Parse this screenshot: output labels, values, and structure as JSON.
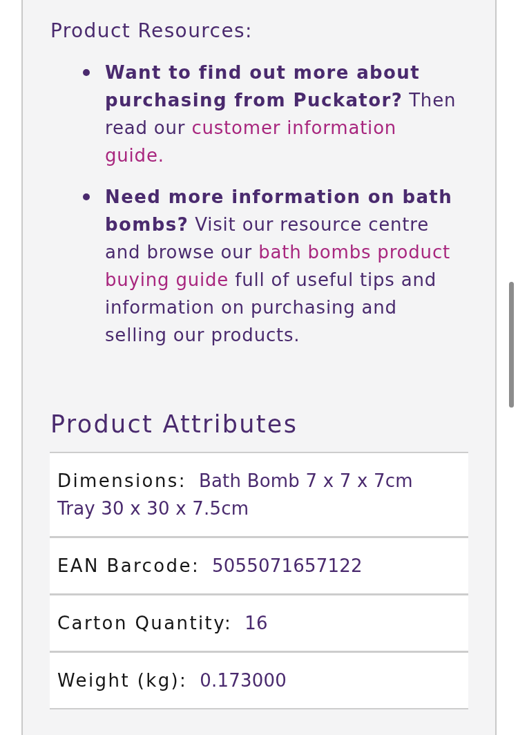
{
  "resources": {
    "heading": "Product Resources:",
    "items": [
      {
        "parts": [
          {
            "kind": "text",
            "text": "**Want to find out more about purchasing from Puckator?** Then read our"
          },
          {
            "kind": "link",
            "text": "customer information"
          },
          {
            "kind": "link",
            "text": "guide."
          }
        ]
      },
      {
        "parts": [
          {
            "kind": "text",
            "text": "**Need more information on bath bombs?** Visit our resource centre and browse our"
          },
          {
            "kind": "link",
            "text": "bath bombs product"
          },
          {
            "kind": "link",
            "text": "buying guide"
          },
          {
            "kind": "text",
            "text": "full of useful tips and information on purchasing and selling our products."
          }
        ]
      }
    ]
  },
  "attributes": {
    "heading": "Product Attributes",
    "rows": [
      {
        "label": "Dimensions:",
        "values": [
          "Bath Bomb 7 x 7 x 7cm",
          "Tray 30 x 30 x 7.5cm"
        ]
      },
      {
        "label": "EAN Barcode:",
        "values": [
          "5055071657122"
        ]
      },
      {
        "label": "Carton Quantity:",
        "values": [
          "16"
        ]
      },
      {
        "label": "Weight (kg):",
        "values": [
          "0.173000"
        ]
      }
    ]
  }
}
